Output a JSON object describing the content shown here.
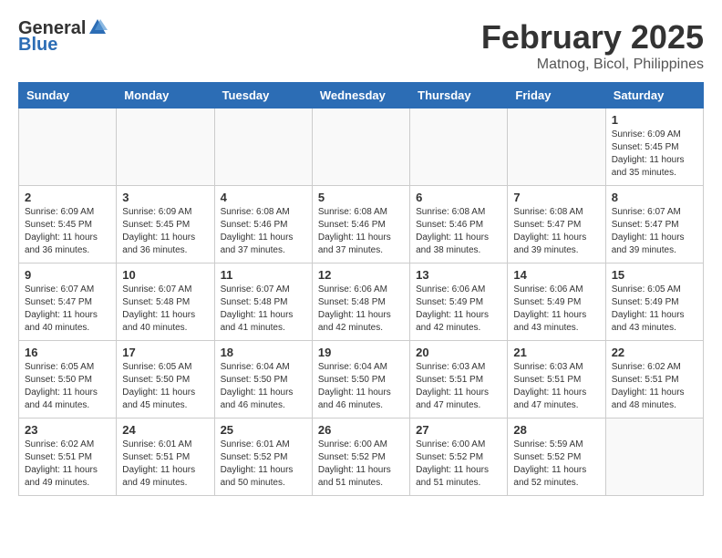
{
  "logo": {
    "general": "General",
    "blue": "Blue"
  },
  "header": {
    "title": "February 2025",
    "subtitle": "Matnog, Bicol, Philippines"
  },
  "weekdays": [
    "Sunday",
    "Monday",
    "Tuesday",
    "Wednesday",
    "Thursday",
    "Friday",
    "Saturday"
  ],
  "weeks": [
    [
      {
        "day": "",
        "info": ""
      },
      {
        "day": "",
        "info": ""
      },
      {
        "day": "",
        "info": ""
      },
      {
        "day": "",
        "info": ""
      },
      {
        "day": "",
        "info": ""
      },
      {
        "day": "",
        "info": ""
      },
      {
        "day": "1",
        "info": "Sunrise: 6:09 AM\nSunset: 5:45 PM\nDaylight: 11 hours\nand 35 minutes."
      }
    ],
    [
      {
        "day": "2",
        "info": "Sunrise: 6:09 AM\nSunset: 5:45 PM\nDaylight: 11 hours\nand 36 minutes."
      },
      {
        "day": "3",
        "info": "Sunrise: 6:09 AM\nSunset: 5:45 PM\nDaylight: 11 hours\nand 36 minutes."
      },
      {
        "day": "4",
        "info": "Sunrise: 6:08 AM\nSunset: 5:46 PM\nDaylight: 11 hours\nand 37 minutes."
      },
      {
        "day": "5",
        "info": "Sunrise: 6:08 AM\nSunset: 5:46 PM\nDaylight: 11 hours\nand 37 minutes."
      },
      {
        "day": "6",
        "info": "Sunrise: 6:08 AM\nSunset: 5:46 PM\nDaylight: 11 hours\nand 38 minutes."
      },
      {
        "day": "7",
        "info": "Sunrise: 6:08 AM\nSunset: 5:47 PM\nDaylight: 11 hours\nand 39 minutes."
      },
      {
        "day": "8",
        "info": "Sunrise: 6:07 AM\nSunset: 5:47 PM\nDaylight: 11 hours\nand 39 minutes."
      }
    ],
    [
      {
        "day": "9",
        "info": "Sunrise: 6:07 AM\nSunset: 5:47 PM\nDaylight: 11 hours\nand 40 minutes."
      },
      {
        "day": "10",
        "info": "Sunrise: 6:07 AM\nSunset: 5:48 PM\nDaylight: 11 hours\nand 40 minutes."
      },
      {
        "day": "11",
        "info": "Sunrise: 6:07 AM\nSunset: 5:48 PM\nDaylight: 11 hours\nand 41 minutes."
      },
      {
        "day": "12",
        "info": "Sunrise: 6:06 AM\nSunset: 5:48 PM\nDaylight: 11 hours\nand 42 minutes."
      },
      {
        "day": "13",
        "info": "Sunrise: 6:06 AM\nSunset: 5:49 PM\nDaylight: 11 hours\nand 42 minutes."
      },
      {
        "day": "14",
        "info": "Sunrise: 6:06 AM\nSunset: 5:49 PM\nDaylight: 11 hours\nand 43 minutes."
      },
      {
        "day": "15",
        "info": "Sunrise: 6:05 AM\nSunset: 5:49 PM\nDaylight: 11 hours\nand 43 minutes."
      }
    ],
    [
      {
        "day": "16",
        "info": "Sunrise: 6:05 AM\nSunset: 5:50 PM\nDaylight: 11 hours\nand 44 minutes."
      },
      {
        "day": "17",
        "info": "Sunrise: 6:05 AM\nSunset: 5:50 PM\nDaylight: 11 hours\nand 45 minutes."
      },
      {
        "day": "18",
        "info": "Sunrise: 6:04 AM\nSunset: 5:50 PM\nDaylight: 11 hours\nand 46 minutes."
      },
      {
        "day": "19",
        "info": "Sunrise: 6:04 AM\nSunset: 5:50 PM\nDaylight: 11 hours\nand 46 minutes."
      },
      {
        "day": "20",
        "info": "Sunrise: 6:03 AM\nSunset: 5:51 PM\nDaylight: 11 hours\nand 47 minutes."
      },
      {
        "day": "21",
        "info": "Sunrise: 6:03 AM\nSunset: 5:51 PM\nDaylight: 11 hours\nand 47 minutes."
      },
      {
        "day": "22",
        "info": "Sunrise: 6:02 AM\nSunset: 5:51 PM\nDaylight: 11 hours\nand 48 minutes."
      }
    ],
    [
      {
        "day": "23",
        "info": "Sunrise: 6:02 AM\nSunset: 5:51 PM\nDaylight: 11 hours\nand 49 minutes."
      },
      {
        "day": "24",
        "info": "Sunrise: 6:01 AM\nSunset: 5:51 PM\nDaylight: 11 hours\nand 49 minutes."
      },
      {
        "day": "25",
        "info": "Sunrise: 6:01 AM\nSunset: 5:52 PM\nDaylight: 11 hours\nand 50 minutes."
      },
      {
        "day": "26",
        "info": "Sunrise: 6:00 AM\nSunset: 5:52 PM\nDaylight: 11 hours\nand 51 minutes."
      },
      {
        "day": "27",
        "info": "Sunrise: 6:00 AM\nSunset: 5:52 PM\nDaylight: 11 hours\nand 51 minutes."
      },
      {
        "day": "28",
        "info": "Sunrise: 5:59 AM\nSunset: 5:52 PM\nDaylight: 11 hours\nand 52 minutes."
      },
      {
        "day": "",
        "info": ""
      }
    ]
  ]
}
